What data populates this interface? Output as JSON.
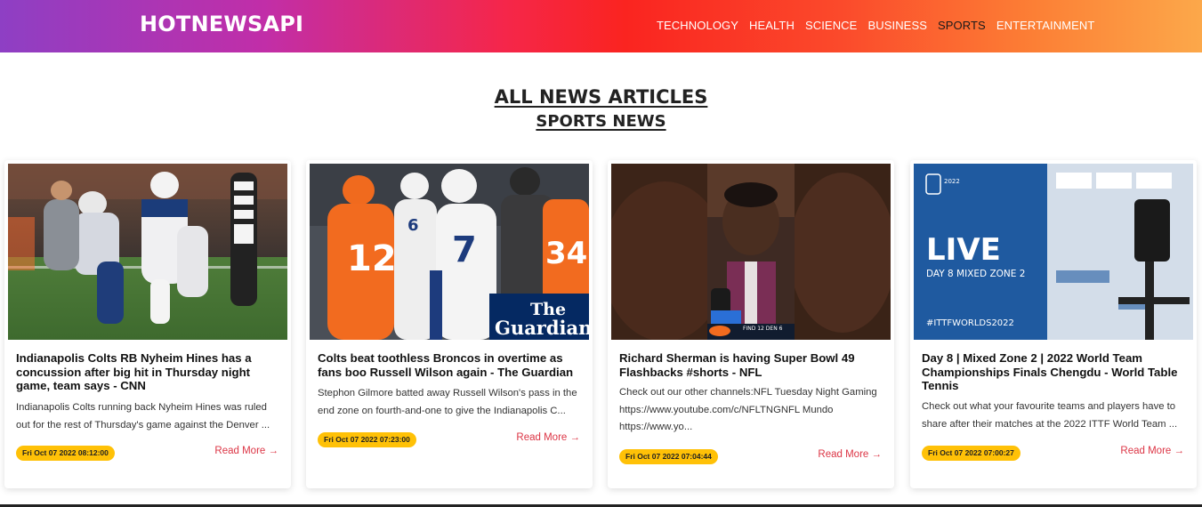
{
  "brand": "HOTNEWSAPI",
  "nav": {
    "items": [
      {
        "label": "TECHNOLOGY",
        "active": false
      },
      {
        "label": "HEALTH",
        "active": false
      },
      {
        "label": "SCIENCE",
        "active": false
      },
      {
        "label": "BUSINESS",
        "active": false
      },
      {
        "label": "SPORTS",
        "active": true
      },
      {
        "label": "ENTERTAINMENT",
        "active": false
      }
    ]
  },
  "page": {
    "heading": "ALL NEWS ARTICLES",
    "subheading": "SPORTS NEWS"
  },
  "colors": {
    "gradient": [
      "#8e3fc4",
      "#fa2420",
      "#fca84a"
    ],
    "badge": "#ffc107",
    "read_more": "#dc3545"
  },
  "articles": [
    {
      "title": "Indianapolis Colts RB Nyheim Hines has a concussion after big hit in Thursday night game, team says - CNN",
      "description": "Indianapolis Colts running back Nyheim Hines was ruled out for the rest of Thursday's game against the Denver ...",
      "date": "Fri Oct 07 2022 08:12:00",
      "read_more": "Read More",
      "image": "football-players-field-photo"
    },
    {
      "title": "Colts beat toothless Broncos in overtime as fans boo Russell Wilson again - The Guardian",
      "description": "Stephon Gilmore batted away Russell Wilson's pass in the end zone on fourth-and-one to give the Indianapolis C...",
      "date": "Fri Oct 07 2022 07:23:00",
      "read_more": "Read More",
      "image": "players-with-guardian-logo-photo",
      "image_logo": "The Guardian"
    },
    {
      "title": "Richard Sherman is having Super Bowl 49 Flashbacks #shorts - NFL",
      "description": "Check out our other channels:NFL Tuesday Night Gaming https://www.youtube.com/c/NFLTNGNFL Mundo https://www.yo...",
      "date": "Fri Oct 07 2022 07:04:44",
      "read_more": "Read More",
      "image": "broadcaster-portrait-photo"
    },
    {
      "title": "Day 8 | Mixed Zone 2 | 2022 World Team Championships Finals Chengdu - World Table Tennis",
      "description": "Check out what your favourite teams and players have to share after their matches at the 2022 ITTF World Team ...",
      "date": "Fri Oct 07 2022 07:00:27",
      "read_more": "Read More",
      "image": "ittf-live-mixed-zone-photo",
      "image_text": {
        "live": "LIVE",
        "sub": "DAY 8 MIXED ZONE 2",
        "tag": "#ITTFWORLDS2022"
      }
    }
  ]
}
